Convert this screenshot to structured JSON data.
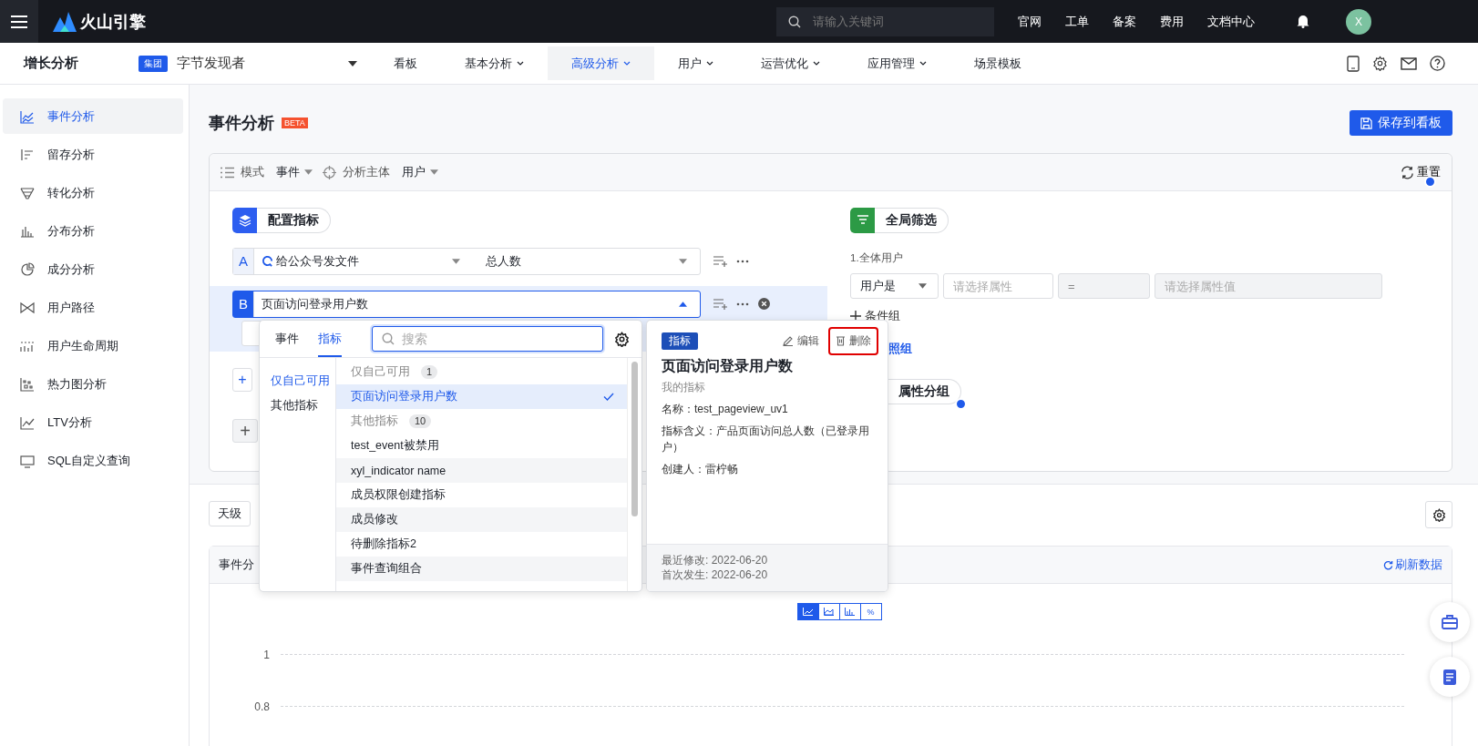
{
  "top_bar": {
    "brand": "火山引擎",
    "search": {
      "placeholder": "请输入关键词"
    },
    "links": [
      "官网",
      "工单",
      "备案",
      "费用",
      "文档中心"
    ],
    "avatar": "X"
  },
  "nav": {
    "product": "增长分析",
    "org_badge": "集团",
    "app": "字节发现者",
    "items": [
      {
        "label": "看板",
        "dropdown": false,
        "selected": false
      },
      {
        "label": "基本分析",
        "dropdown": true,
        "selected": false
      },
      {
        "label": "高级分析",
        "dropdown": true,
        "selected": true
      },
      {
        "label": "用户",
        "dropdown": true,
        "selected": false
      },
      {
        "label": "运营优化",
        "dropdown": true,
        "selected": false
      },
      {
        "label": "应用管理",
        "dropdown": true,
        "selected": false
      },
      {
        "label": "场景模板",
        "dropdown": false,
        "selected": false
      }
    ]
  },
  "sidebar": {
    "items": [
      {
        "label": "事件分析",
        "kind": "trend",
        "selected": true
      },
      {
        "label": "留存分析",
        "kind": "retention",
        "selected": false
      },
      {
        "label": "转化分析",
        "kind": "funnel",
        "selected": false
      },
      {
        "label": "分布分析",
        "kind": "bars",
        "selected": false
      },
      {
        "label": "成分分析",
        "kind": "pie",
        "selected": false
      },
      {
        "label": "用户路径",
        "kind": "path",
        "selected": false
      },
      {
        "label": "用户生命周期",
        "kind": "lifecycle",
        "selected": false
      },
      {
        "label": "热力图分析",
        "kind": "heatmap",
        "selected": false
      },
      {
        "label": "LTV分析",
        "kind": "ltv",
        "selected": false
      },
      {
        "label": "SQL自定义查询",
        "kind": "sql",
        "selected": false
      }
    ]
  },
  "page": {
    "title": "事件分析",
    "badge": "BETA",
    "save_button": "保存到看板"
  },
  "config": {
    "mode_label": "模式",
    "mode": "事件",
    "subject_label": "分析主体",
    "subject": "用户",
    "reset": "重置",
    "metrics_title": "配置指标",
    "metrics": [
      {
        "letter": "A",
        "event": "给公众号发文件",
        "measure": "总人数",
        "open": false,
        "removable": false
      },
      {
        "letter": "B",
        "event": "页面访问登录用户数",
        "open": true,
        "removable": true
      }
    ],
    "filter_title": "全局筛选",
    "filter_group": "1.全体用户",
    "filter": {
      "subject": "用户是",
      "property_placeholder": "请选择属性",
      "operator": "=",
      "value_placeholder": "请选择属性值"
    },
    "add_metric": "+",
    "add_group": "+",
    "add_condition": "条件组",
    "compare_link": "照组",
    "group_title": "属性分组"
  },
  "toolbar": {
    "granularity": "天级"
  },
  "chart": {
    "title": "事件分",
    "refresh": "刷新数据",
    "types": [
      {
        "kind": "line",
        "selected": true
      },
      {
        "kind": "area",
        "selected": false
      },
      {
        "kind": "bar",
        "selected": false
      },
      {
        "kind": "percent",
        "label": "%",
        "selected": false
      }
    ],
    "y_labels": [
      "1",
      "0.8"
    ]
  },
  "picker": {
    "tabs": [
      {
        "label": "事件",
        "selected": false
      },
      {
        "label": "指标",
        "selected": true
      }
    ],
    "search_placeholder": "搜索",
    "categories": [
      {
        "label": "仅自己可用",
        "selected": true
      },
      {
        "label": "其他指标",
        "selected": false
      }
    ],
    "items": [
      {
        "kind": "header",
        "label": "仅自己可用",
        "count": "1"
      },
      {
        "kind": "item",
        "label": "页面访问登录用户数",
        "selected": true
      },
      {
        "kind": "header",
        "label": "其他指标",
        "count": "10"
      },
      {
        "kind": "item",
        "label": "test_event被禁用",
        "selected": false
      },
      {
        "kind": "item",
        "label": "xyl_indicator name",
        "selected": false
      },
      {
        "kind": "item",
        "label": "成员权限创建指标",
        "selected": false
      },
      {
        "kind": "item",
        "label": "成员修改",
        "selected": false
      },
      {
        "kind": "item",
        "label": "待删除指标2",
        "selected": false
      },
      {
        "kind": "item",
        "label": "事件查询组合",
        "selected": false
      }
    ]
  },
  "detail": {
    "badge": "指标",
    "edit": "编辑",
    "delete": "删除",
    "delete_highlighted": true,
    "title": "页面访问登录用户数",
    "subtitle": "我的指标",
    "fields": [
      "名称：test_pageview_uv1",
      "指标含义：产品页面访问总人数（已登录用户）",
      "创建人：雷柠畅"
    ],
    "footer": [
      "最近修改: 2022-06-20",
      "首次发生: 2022-06-20"
    ]
  }
}
